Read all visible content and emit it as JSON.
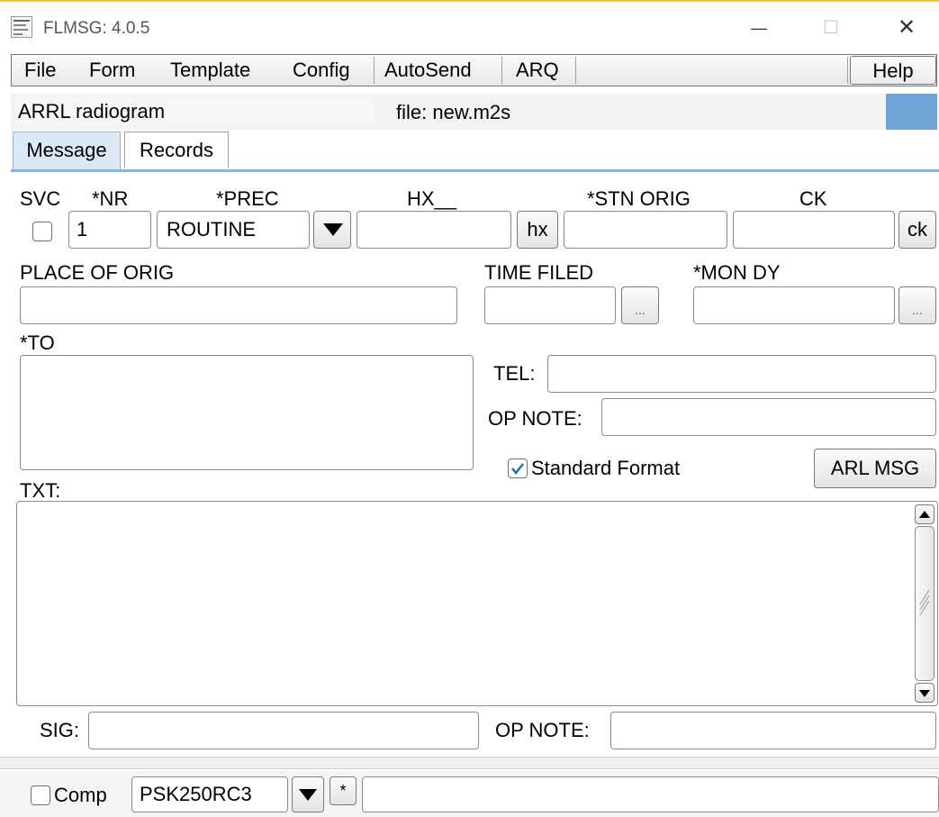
{
  "window": {
    "title": "FLMSG: 4.0.5",
    "controls": {
      "minimize": "—",
      "maximize": "☐",
      "close": "✕"
    }
  },
  "menu": {
    "items": [
      "File",
      "Form",
      "Template",
      "Config",
      "AutoSend",
      "ARQ"
    ],
    "help": "Help"
  },
  "form_bar": {
    "form_name": "ARRL radiogram",
    "file_label": "file: new.m2s"
  },
  "tabs": {
    "message": "Message",
    "records": "Records",
    "active": "Message"
  },
  "labels": {
    "svc": "SVC",
    "nr": "*NR",
    "prec": "*PREC",
    "hx": "HX__",
    "stn_orig": "*STN ORIG",
    "ck": "CK",
    "place_of_orig": "PLACE OF ORIG",
    "time_filed": "TIME FILED",
    "mon_dy": "*MON DY",
    "to": "*TO",
    "tel": "TEL:",
    "op_note": "OP NOTE:",
    "txt": "TXT:",
    "sig": "SIG:",
    "op_note2": "OP NOTE:"
  },
  "fields": {
    "svc_checked": false,
    "nr": "1",
    "prec": "ROUTINE",
    "hx": "",
    "stn_orig": "",
    "ck": "",
    "place_of_orig": "",
    "time_filed": "",
    "mon_dy": "",
    "to": "",
    "tel": "",
    "op_note": "",
    "txt": "",
    "sig": "",
    "op_note2": ""
  },
  "buttons": {
    "hx": "hx",
    "ck": "ck",
    "time_picker": "...",
    "date_picker": "...",
    "arl_msg": "ARL MSG"
  },
  "standard_format": {
    "label": "Standard Format",
    "checked": true
  },
  "bottom": {
    "comp_label": "Comp",
    "comp_checked": false,
    "mode": "PSK250RC3",
    "star": "*",
    "status": ""
  },
  "colors": {
    "accent": "#6fa5d6",
    "tab_active": "#dbe8f6",
    "title_border": "#e6c545"
  }
}
